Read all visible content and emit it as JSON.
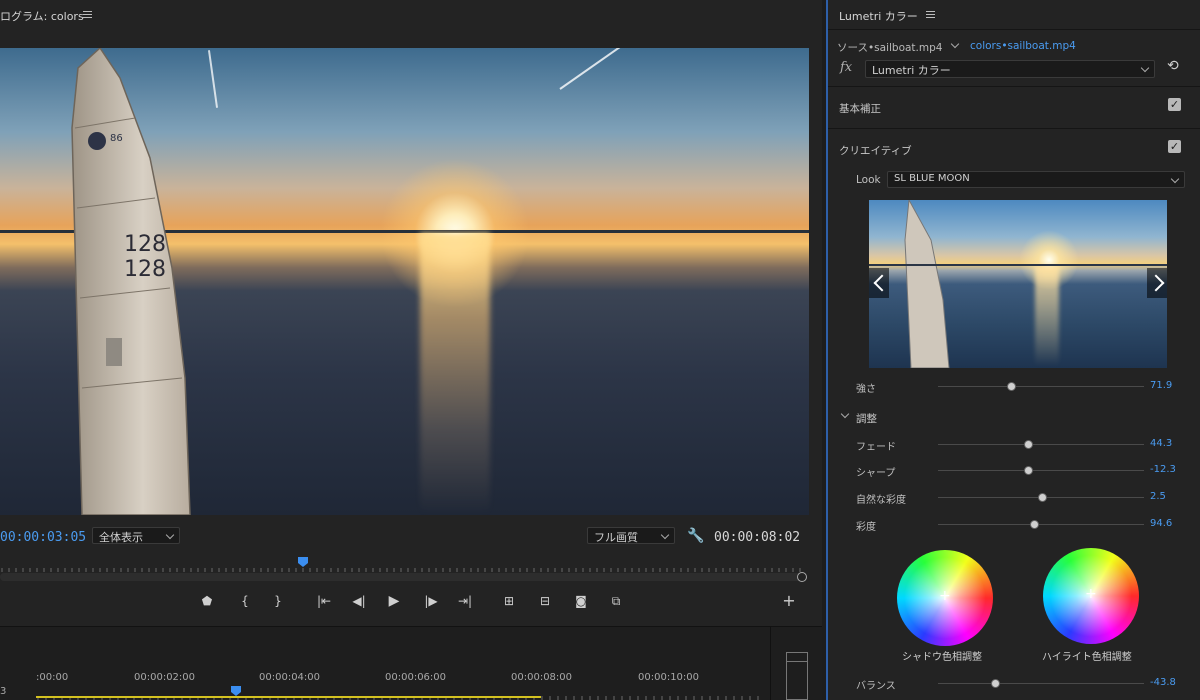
{
  "program": {
    "title": "ログラム: colors",
    "timecode_current": "00:00:03:05",
    "zoom": "全体表示",
    "quality": "フル画質",
    "timecode_duration": "00:00:08:02"
  },
  "video_frame": {
    "sail_numbers": [
      "128",
      "128"
    ],
    "sail_top_text": "86"
  },
  "timeline": {
    "times": [
      ":00:00",
      "00:00:02:00",
      "00:00:04:00",
      "00:00:06:00",
      "00:00:08:00",
      "00:00:10:00"
    ],
    "left_edge": "3"
  },
  "lumetri": {
    "title": "Lumetri カラー",
    "source_tab": "ソース•sailboat.mp4",
    "clip_tab": "colors•sailboat.mp4",
    "fx_label": "fx",
    "effect": "Lumetri カラー",
    "basic_correction": "基本補正",
    "creative": "クリエイティブ",
    "look_label": "Look",
    "look_value": "SL BLUE MOON",
    "intensity": {
      "label": "強さ",
      "value": "71.9",
      "level": 0.36
    },
    "adjust_label": "調整",
    "sliders": [
      {
        "label": "フェード",
        "value": "44.3",
        "level": 0.44
      },
      {
        "label": "シャープ",
        "value": "-12.3",
        "level": 0.44
      },
      {
        "label": "自然な彩度",
        "value": "2.5",
        "level": 0.51
      },
      {
        "label": "彩度",
        "value": "94.6",
        "level": 0.47
      }
    ],
    "shadow_wheel_label": "シャドウ色相調整",
    "highlight_wheel_label": "ハイライト色相調整",
    "balance": {
      "label": "バランス",
      "value": "-43.8",
      "level": 0.28
    }
  }
}
